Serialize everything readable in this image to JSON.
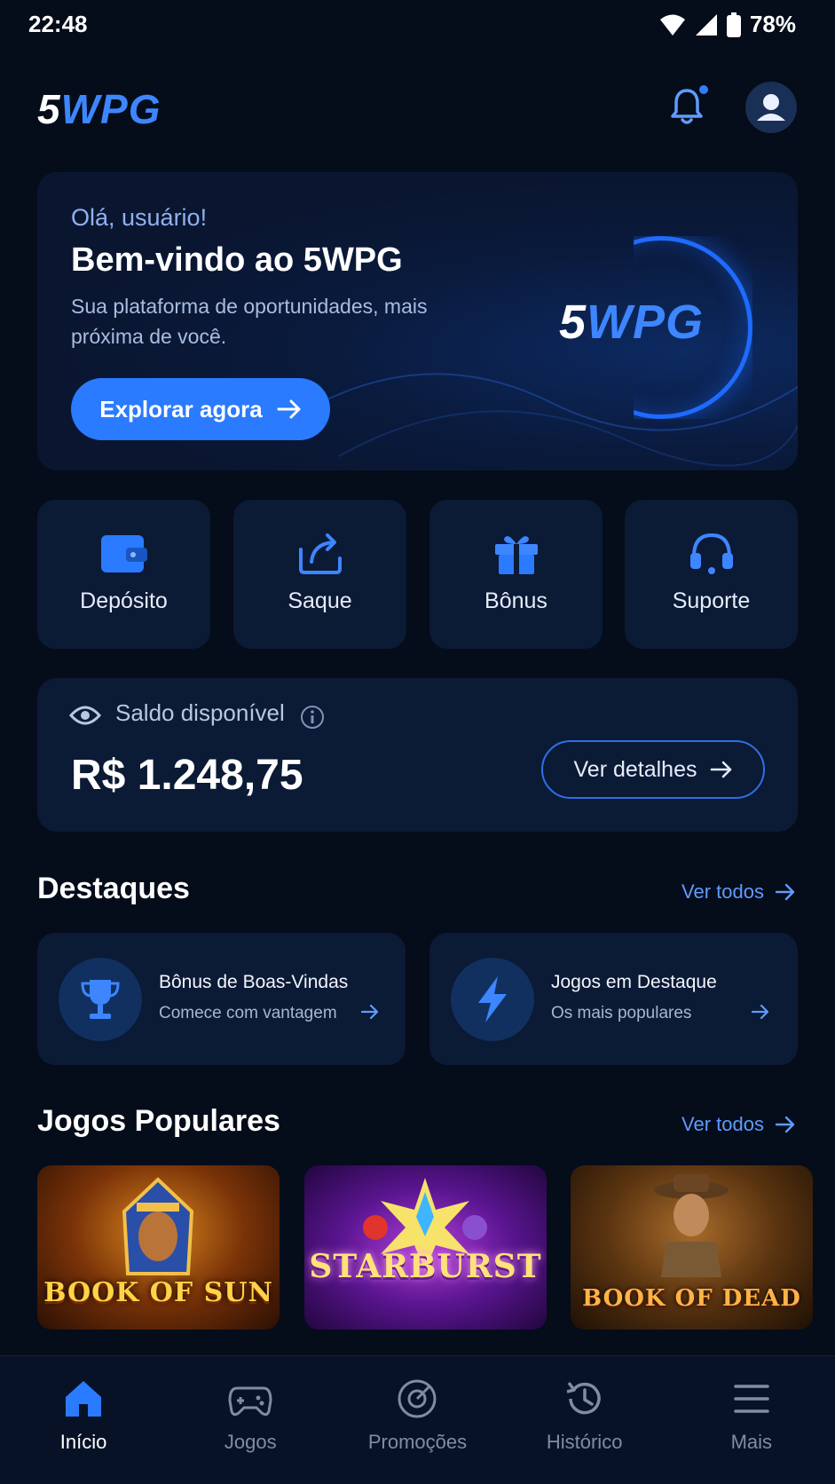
{
  "status_bar": {
    "time": "22:48",
    "battery": "78%"
  },
  "header": {
    "logo_part1": "5",
    "logo_part2": "WPG"
  },
  "hero": {
    "greeting": "Olá, usuário!",
    "title": "Bem-vindo ao 5WPG",
    "subtitle": "Sua plataforma de oportunidades, mais próxima de você.",
    "cta": "Explorar agora",
    "logo_part1": "5",
    "logo_part2": "WPG"
  },
  "quick_actions": [
    {
      "label": "Depósito",
      "icon": "wallet-icon"
    },
    {
      "label": "Saque",
      "icon": "withdraw-icon"
    },
    {
      "label": "Bônus",
      "icon": "gift-icon"
    },
    {
      "label": "Suporte",
      "icon": "headset-icon"
    }
  ],
  "balance": {
    "label": "Saldo disponível",
    "amount": "R$ 1.248,75",
    "button": "Ver detalhes"
  },
  "highlights": {
    "title": "Destaques",
    "see_all": "Ver todos",
    "cards": [
      {
        "title": "Bônus de Boas-Vindas",
        "subtitle": "Comece com vantagem",
        "icon": "trophy-icon"
      },
      {
        "title": "Jogos em Destaque",
        "subtitle": "Os mais populares",
        "icon": "lightning-icon"
      }
    ]
  },
  "popular_games": {
    "title": "Jogos Populares",
    "see_all": "Ver todos",
    "games": [
      {
        "title": "BOOK OF SUN"
      },
      {
        "title": "STARBURST"
      },
      {
        "title": "BOOK OF DEAD"
      }
    ]
  },
  "bottom_nav": [
    {
      "label": "Início",
      "icon": "home-icon",
      "active": true
    },
    {
      "label": "Jogos",
      "icon": "gamepad-icon",
      "active": false
    },
    {
      "label": "Promoções",
      "icon": "target-icon",
      "active": false
    },
    {
      "label": "Histórico",
      "icon": "history-icon",
      "active": false
    },
    {
      "label": "Mais",
      "icon": "menu-icon",
      "active": false
    }
  ],
  "colors": {
    "accent": "#2a7bff",
    "background": "#050c1a",
    "card": "#0b1a35"
  }
}
